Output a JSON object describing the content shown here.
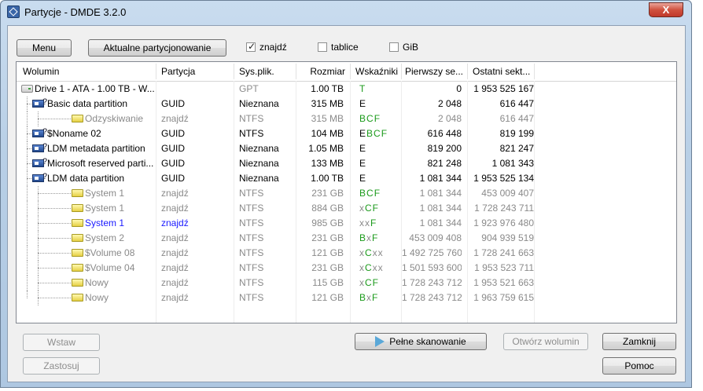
{
  "window": {
    "title": "Partycje - DMDE 3.2.0",
    "close_glyph": "X"
  },
  "toolbar": {
    "menu_label": "Menu",
    "current_label": "Aktualne partycjonowanie",
    "found": {
      "label": "znajdź",
      "checked": true
    },
    "tables": {
      "label": "tablice",
      "checked": false
    },
    "gib": {
      "label": "GiB",
      "checked": false
    }
  },
  "columns": [
    "Wolumin",
    "Partycja",
    "Sys.plik.",
    "Rozmiar",
    "Wskaźniki",
    "Pierwszy se...",
    "Ostatni sekt..."
  ],
  "rows": [
    {
      "name": "Drive 1 - ATA - 1.00 TB - W...",
      "part": "",
      "fs": "GPT",
      "size": "1.00 TB",
      "flags": "T",
      "first": "0",
      "last": "1 953 525 167",
      "icon": "drive",
      "level": 0,
      "style": "drive"
    },
    {
      "name": "Basic data partition",
      "part": "GUID",
      "fs": "Nieznana",
      "size": "315 MB",
      "flags": "E",
      "first": "2 048",
      "last": "616 447",
      "icon": "partition",
      "level": 1,
      "style": "normal"
    },
    {
      "name": "Odzyskiwanie",
      "part": "znajdź",
      "fs": "NTFS",
      "size": "315 MB",
      "flags": "BCF",
      "first": "2 048",
      "last": "616 447",
      "icon": "volume",
      "level": 2,
      "style": "grey"
    },
    {
      "name": "$Noname 02",
      "part": "GUID",
      "fs": "NTFS",
      "size": "104 MB",
      "flags": "EBCF",
      "first": "616 448",
      "last": "819 199",
      "icon": "partition",
      "level": 1,
      "style": "normal"
    },
    {
      "name": "LDM metadata partition",
      "part": "GUID",
      "fs": "Nieznana",
      "size": "1.05 MB",
      "flags": "E",
      "first": "819 200",
      "last": "821 247",
      "icon": "partition",
      "level": 1,
      "style": "normal"
    },
    {
      "name": "Microsoft reserved parti...",
      "part": "GUID",
      "fs": "Nieznana",
      "size": "133 MB",
      "flags": "E",
      "first": "821 248",
      "last": "1 081 343",
      "icon": "partition",
      "level": 1,
      "style": "normal"
    },
    {
      "name": "LDM data partition",
      "part": "GUID",
      "fs": "Nieznana",
      "size": "1.00 TB",
      "flags": "E",
      "first": "1 081 344",
      "last": "1 953 525 134",
      "icon": "partition",
      "level": 1,
      "style": "normal"
    },
    {
      "name": "System 1",
      "part": "znajdź",
      "fs": "NTFS",
      "size": "231 GB",
      "flags": "BCF",
      "first": "1 081 344",
      "last": "453 009 407",
      "icon": "volume",
      "level": 2,
      "style": "grey"
    },
    {
      "name": "System 1",
      "part": "znajdź",
      "fs": "NTFS",
      "size": "884 GB",
      "flags": "xCF",
      "first": "1 081 344",
      "last": "1 728 243 711",
      "icon": "volume",
      "level": 2,
      "style": "grey"
    },
    {
      "name": "System 1",
      "part": "znajdź",
      "fs": "NTFS",
      "size": "985 GB",
      "flags": "xxF",
      "first": "1 081 344",
      "last": "1 923 976 480",
      "icon": "volume",
      "level": 2,
      "style": "blue"
    },
    {
      "name": "System 2",
      "part": "znajdź",
      "fs": "NTFS",
      "size": "231 GB",
      "flags": "BxF",
      "first": "453 009 408",
      "last": "904 939 519",
      "icon": "volume",
      "level": 2,
      "style": "grey"
    },
    {
      "name": "$Volume 08",
      "part": "znajdź",
      "fs": "NTFS",
      "size": "121 GB",
      "flags": "xCxx",
      "first": "1 492 725 760",
      "last": "1 728 241 663",
      "icon": "volume",
      "level": 2,
      "style": "grey"
    },
    {
      "name": "$Volume 04",
      "part": "znajdź",
      "fs": "NTFS",
      "size": "231 GB",
      "flags": "xCxx",
      "first": "1 501 593 600",
      "last": "1 953 523 711",
      "icon": "volume",
      "level": 2,
      "style": "grey"
    },
    {
      "name": "Nowy",
      "part": "znajdź",
      "fs": "NTFS",
      "size": "115 GB",
      "flags": "xCF",
      "first": "1 728 243 712",
      "last": "1 953 521 663",
      "icon": "volume",
      "level": 2,
      "style": "grey"
    },
    {
      "name": "Nowy",
      "part": "znajdź",
      "fs": "NTFS",
      "size": "121 GB",
      "flags": "BxF",
      "first": "1 728 243 712",
      "last": "1 963 759 615",
      "icon": "volume",
      "level": 2,
      "style": "grey"
    }
  ],
  "buttons": {
    "insert": "Wstaw",
    "apply": "Zastosuj",
    "full_scan": "Pełne skanowanie",
    "open_volume": "Otwórz wolumin",
    "close": "Zamknij",
    "help": "Pomoc"
  },
  "colors": {
    "flag_green": "#1a9a1a",
    "blue_text": "#1a1aff",
    "grey_text": "#8a8a8a"
  }
}
